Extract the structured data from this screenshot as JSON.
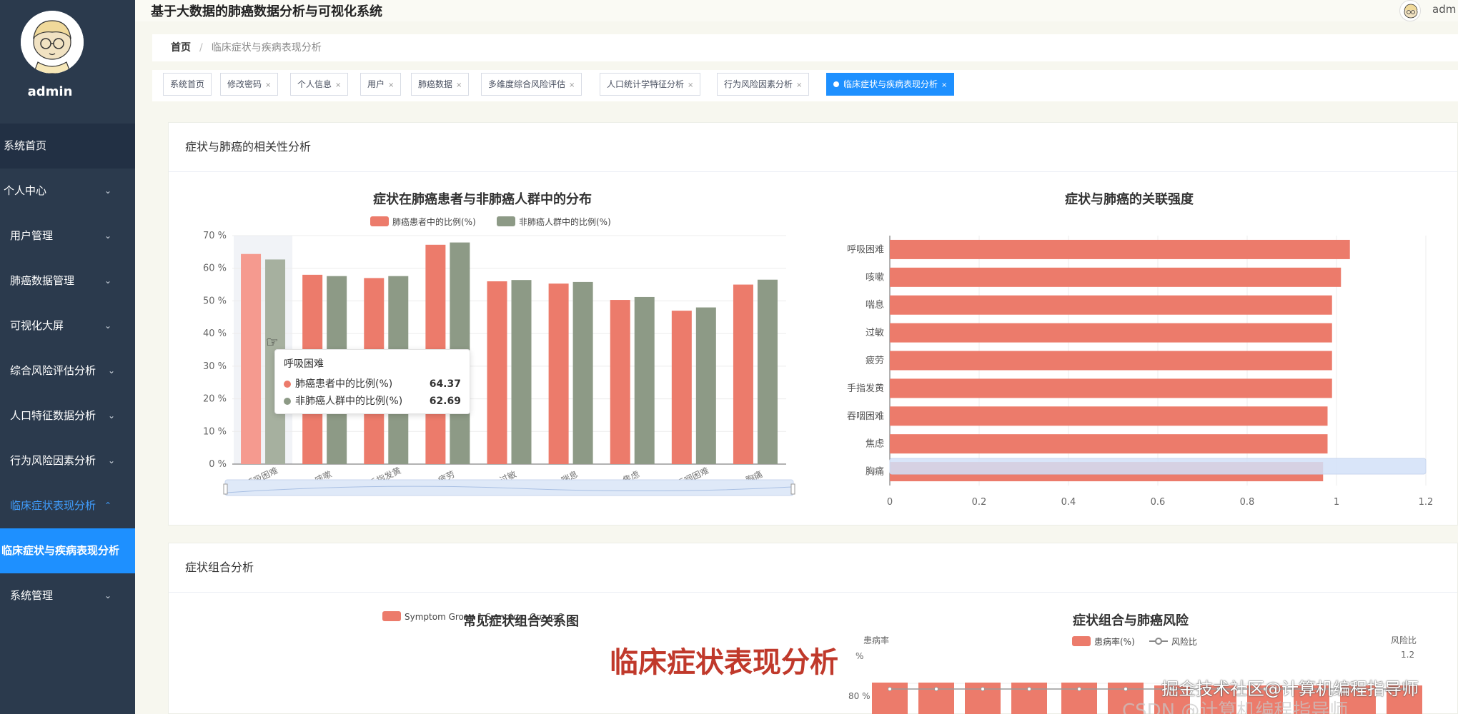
{
  "app": {
    "title": "基于大数据的肺癌数据分析与可视化系统",
    "user": "admin",
    "header_user": "adm"
  },
  "sidebar": {
    "items": [
      {
        "label": "系统首页"
      },
      {
        "label": "个人中心"
      },
      {
        "label": "用户管理"
      },
      {
        "label": "肺癌数据管理"
      },
      {
        "label": "可视化大屏"
      },
      {
        "label": "综合风险评估分析"
      },
      {
        "label": "人口特征数据分析"
      },
      {
        "label": "行为风险因素分析"
      },
      {
        "label": "临床症状表现分析"
      },
      {
        "label": "临床症状与疾病表现分析"
      },
      {
        "label": "系统管理"
      }
    ]
  },
  "breadcrumb": {
    "home": "首页",
    "separator": "/",
    "current": "临床症状与疾病表现分析"
  },
  "tags": [
    {
      "label": "系统首页",
      "closable": false
    },
    {
      "label": "修改密码",
      "closable": true
    },
    {
      "label": "个人信息",
      "closable": true
    },
    {
      "label": "用户",
      "closable": true
    },
    {
      "label": "肺癌数据",
      "closable": true
    },
    {
      "label": "多维度综合风险评估",
      "closable": true
    },
    {
      "label": "人口统计学特征分析",
      "closable": true
    },
    {
      "label": "行为风险因素分析",
      "closable": true
    },
    {
      "label": "临床症状与疾病表现分析",
      "closable": true,
      "active": true
    }
  ],
  "tag_close_glyph": "×",
  "colors": {
    "accent": "#1e90ff",
    "sidebar_bg": "#2b3a4d",
    "cancer_bar": "#ec7b6b",
    "non_cancer_bar": "#8d9a86",
    "overlay_red": "#c0392b"
  },
  "card1": {
    "title": "症状与肺癌的相关性分析"
  },
  "card2": {
    "title": "症状组合分析",
    "left_chart_title": "常见症状组合关系图",
    "left_legend": "Symptom Group 1   Symptom Group 2",
    "right_chart_title": "症状组合与肺癌风险",
    "right_legend_1": "患病率(%)",
    "right_legend_2": "风险比",
    "right_y_left_label": "患病率",
    "right_y_right_label": "风险比",
    "right_y_right_top_tick": "1.2",
    "right_y_left_top_tick": "% ",
    "right_y_left_tick_80": "80 %"
  },
  "tooltip": {
    "title": "呼吸困难",
    "rows": [
      {
        "label": "肺癌患者中的比例(%)",
        "value": "64.37"
      },
      {
        "label": "非肺癌人群中的比例(%)",
        "value": "62.69"
      }
    ]
  },
  "overlay_title": "临床症状表现分析",
  "watermark": "掘金技术社区@计算机编程指导师",
  "watermark_faint": "CSDN @计算机编程指导师",
  "chart_data": [
    {
      "type": "bar",
      "title": "症状在肺癌患者与非肺癌人群中的分布",
      "categories": [
        "呼吸困难",
        "咳嗽",
        "手指发黄",
        "疲劳",
        "过敏",
        "喘息",
        "焦虑",
        "吞咽困难",
        "胸痛"
      ],
      "series": [
        {
          "name": "肺癌患者中的比例(%)",
          "values": [
            64.37,
            58.0,
            57.0,
            67.2,
            56.0,
            55.3,
            50.3,
            47.0,
            55.0
          ]
        },
        {
          "name": "非肺癌人群中的比例(%)",
          "values": [
            62.69,
            57.6,
            57.6,
            67.9,
            56.4,
            55.8,
            51.2,
            48.0,
            56.5
          ]
        }
      ],
      "yticks": [
        "0 %",
        "10 %",
        "20 %",
        "30 %",
        "40 %",
        "50 %",
        "60 %",
        "70 %"
      ],
      "ylim": [
        0,
        70
      ],
      "legend": "top",
      "grid": true
    },
    {
      "type": "bar",
      "orientation": "horizontal",
      "title": "症状与肺癌的关联强度",
      "categories": [
        "呼吸困难",
        "咳嗽",
        "喘息",
        "过敏",
        "疲劳",
        "手指发黄",
        "吞咽困难",
        "焦虑",
        "胸痛"
      ],
      "values": [
        1.03,
        1.01,
        0.99,
        0.99,
        0.99,
        0.99,
        0.98,
        0.98,
        0.97
      ],
      "xticks": [
        "0",
        "0.2",
        "0.4",
        "0.6",
        "0.8",
        "1",
        "1.2"
      ],
      "xlim": [
        0,
        1.2
      ],
      "grid": true
    },
    {
      "type": "bar",
      "title": "症状组合与肺癌风险",
      "series": [
        {
          "name": "患病率(%)"
        },
        {
          "name": "风险比"
        }
      ]
    }
  ]
}
